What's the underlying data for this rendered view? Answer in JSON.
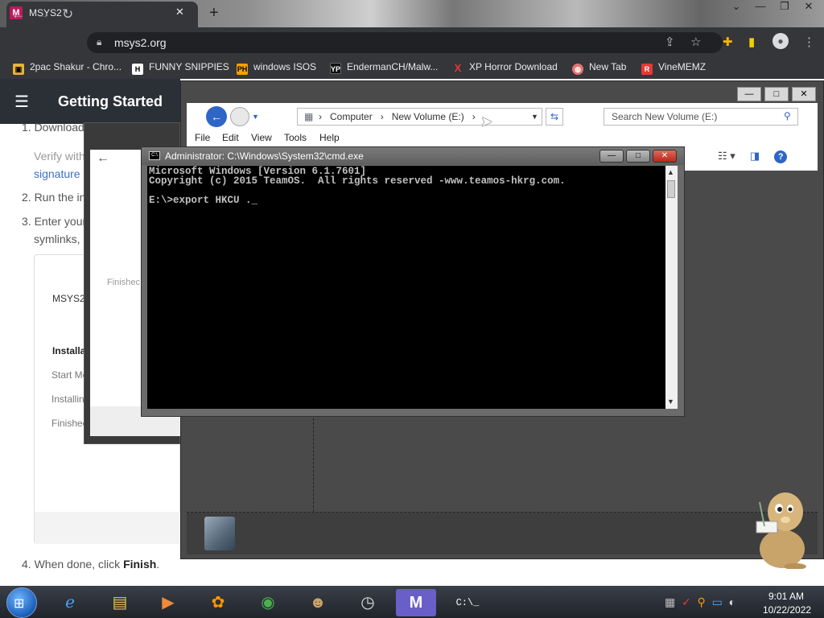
{
  "browser": {
    "tab_title": "MSYS2",
    "tab_favicon": "M",
    "url": "msys2.org",
    "bookmarks": [
      {
        "label": "2pac Shakur - Chro...",
        "icon": "bookmark-2pac-icon",
        "color": "#e8b339"
      },
      {
        "label": "FUNNY SNIPPIES",
        "icon": "H",
        "color": "#ffffff"
      },
      {
        "label": "windows ISOS",
        "icon": "PH",
        "color": "#f4a300"
      },
      {
        "label": "EndermanCH/Malw...",
        "icon": "YP",
        "color": "#ffffff"
      },
      {
        "label": "XP Horror Download",
        "icon": "X",
        "color": "#e53935"
      },
      {
        "label": "New Tab",
        "icon": "globe-icon",
        "color": "#e57373"
      },
      {
        "label": "VineMEMZ",
        "icon": "R",
        "color": "#e53935"
      }
    ]
  },
  "page": {
    "header_title": "Getting Started",
    "step1": "1. Download",
    "verify": "Verify with",
    "signature": "signature",
    "step2": "2. Run the in",
    "step3": "3. Enter your",
    "symlinks": "symlinks,",
    "card_title": "MSYS2",
    "card_install": "Installa",
    "card_start": "Start Me",
    "card_installing": "Installin",
    "card_finished": "Finishec",
    "step4_prefix": "4. When done, click ",
    "step4_bold": "Finish",
    "step4_suffix": "."
  },
  "installer": {
    "finished": "Finishec"
  },
  "explorer": {
    "breadcrumb": [
      "Computer",
      "New Volume (E:)"
    ],
    "search_placeholder": "Search New Volume (E:)",
    "menu": [
      "File",
      "Edit",
      "View",
      "Tools",
      "Help"
    ]
  },
  "cmd": {
    "title": "Administrator: C:\\Windows\\System32\\cmd.exe",
    "lines": [
      "Microsoft Windows [Version 6.1.7601]",
      "Copyright (c) 2015 TeamOS.  All rights reserved -www.teamos-hkrg.com.",
      "",
      "E:\\>export HKCU ._"
    ]
  },
  "taskbar": {
    "time": "9:01 AM",
    "date": "10/22/2022"
  }
}
